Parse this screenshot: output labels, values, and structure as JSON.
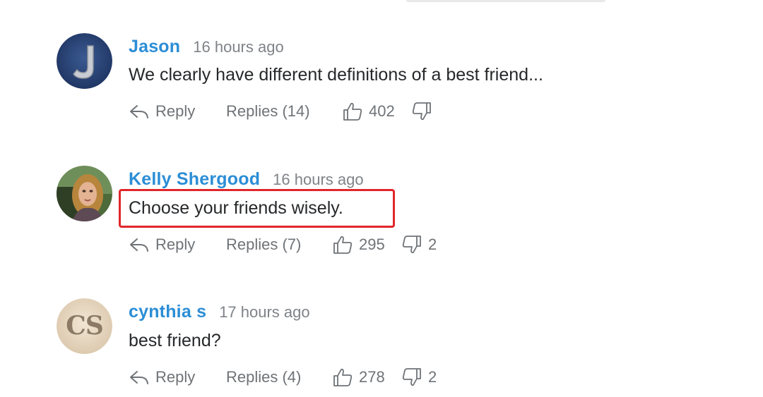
{
  "comments": [
    {
      "author": "Jason",
      "time": "16 hours ago",
      "text": "We clearly have different definitions of a best friend...",
      "avatar_icon": "letter-j-avatar",
      "reply_label": "Reply",
      "replies_label": "Replies (14)",
      "likes": "402",
      "dislikes": ""
    },
    {
      "author": "Kelly Shergood",
      "time": "16 hours ago",
      "text": "Choose your friends wisely.",
      "avatar_icon": "photo-avatar",
      "reply_label": "Reply",
      "replies_label": "Replies (7)",
      "likes": "295",
      "dislikes": "2"
    },
    {
      "author": "cynthia s",
      "time": "17 hours ago",
      "text": "best friend?",
      "avatar_icon": "cs-initials-avatar",
      "avatar_initials": "CS",
      "reply_label": "Reply",
      "replies_label": "Replies (4)",
      "likes": "278",
      "dislikes": "2"
    }
  ],
  "colors": {
    "author": "#2c8ed6",
    "highlight": "#e0262b",
    "action_text": "#6f7377"
  }
}
